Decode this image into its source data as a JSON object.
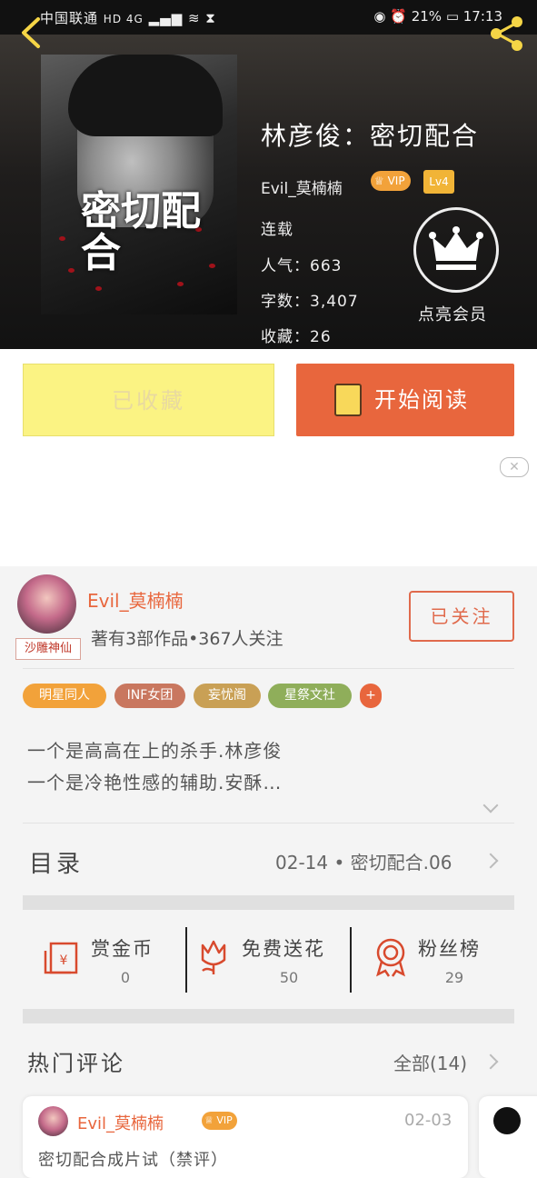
{
  "status_bar": {
    "carrier": "中国联通",
    "network": "HD 4G",
    "battery": "21%",
    "time": "17:13"
  },
  "book": {
    "title": "林彦俊：密切配合",
    "author": "Evil_莫楠楠",
    "vip_label": "VIP",
    "level": "Lv4",
    "status": "连载",
    "popularity_label": "人气：663",
    "words_label": "字数：3,407",
    "favorites_label": "收藏：26",
    "cover_title": "密切配合",
    "member_label": "点亮会员"
  },
  "actions": {
    "collected_label": "已收藏",
    "read_label": "开始阅读"
  },
  "ad": {
    "close_label": "✕"
  },
  "author_section": {
    "name": "Evil_莫楠楠",
    "badge": "沙雕神仙",
    "stats": "著有3部作品•367人关注",
    "follow_label": "已关注"
  },
  "tags": [
    {
      "label": "明星同人",
      "color": "#f2a23a"
    },
    {
      "label": "INF女团",
      "color": "#c9775f"
    },
    {
      "label": "妄忧阁",
      "color": "#c9a055"
    },
    {
      "label": "星祭文社",
      "color": "#8fae5a"
    },
    {
      "label": "+",
      "color": "#e8663d"
    }
  ],
  "description": {
    "line1": "一个是高高在上的杀手.林彦俊",
    "line2": "一个是冷艳性感的辅助.安酥…"
  },
  "toc": {
    "label": "目录",
    "latest": "02-14 • 密切配合.06"
  },
  "stats": {
    "reward": {
      "label": "赏金币",
      "value": "0"
    },
    "flower": {
      "label": "免费送花",
      "value": "50"
    },
    "fans": {
      "label": "粉丝榜",
      "value": "29"
    }
  },
  "comments": {
    "title": "热门评论",
    "all_label": "全部(14)",
    "first": {
      "author": "Evil_莫楠楠",
      "vip": "VIP",
      "date": "02-03",
      "text": "密切配合成片试（禁评）"
    }
  },
  "colors": {
    "accent": "#e8663d",
    "collect_bg": "#fbf383",
    "vip": "#f2a23a"
  }
}
